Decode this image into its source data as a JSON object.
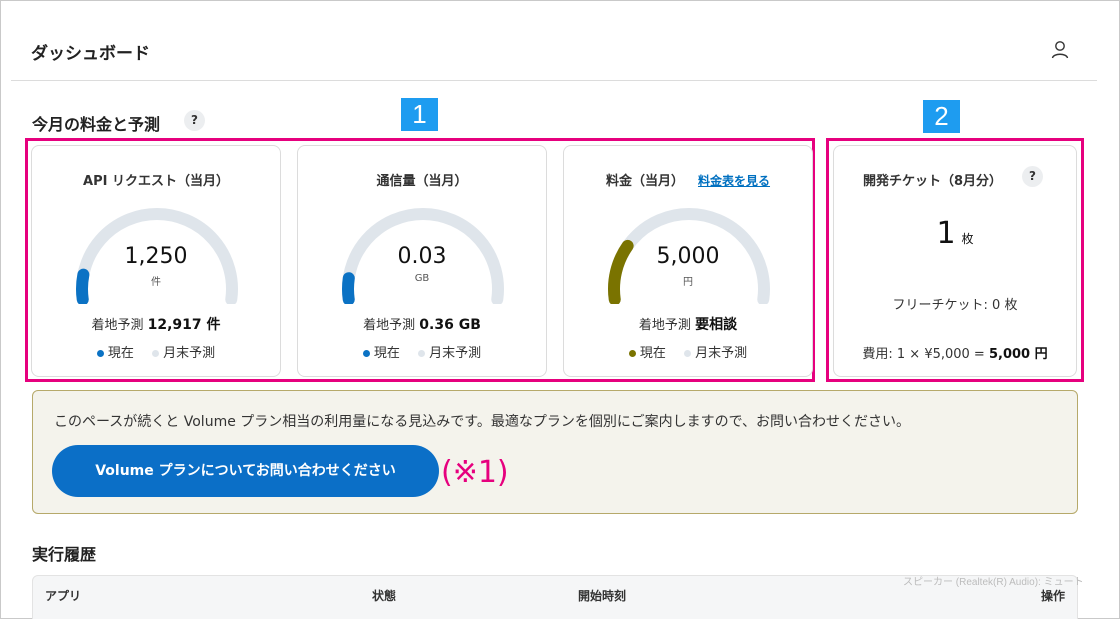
{
  "header": {
    "title": "ダッシュボード",
    "user_icon": "user-icon"
  },
  "billing": {
    "title": "今月の料金と予測",
    "help": "?",
    "markers": [
      "1",
      "2"
    ],
    "cards": [
      {
        "title": "API リクエスト（当月）",
        "value": "1,250",
        "unit": "件",
        "forecast_label": "着地予測",
        "forecast_value": "12,917 件",
        "legend_current": "現在",
        "legend_forecast": "月末予測",
        "progress": 0.097,
        "color": "#0b72c4"
      },
      {
        "title": "通信量（当月）",
        "value": "0.03",
        "unit": "GB",
        "forecast_label": "着地予測",
        "forecast_value": "0.36 GB",
        "legend_current": "現在",
        "legend_forecast": "月末予測",
        "progress": 0.083,
        "color": "#0b72c4"
      },
      {
        "title": "料金（当月）",
        "link": "料金表を見る",
        "value": "5,000",
        "unit": "円",
        "forecast_label": "着地予測",
        "forecast_value": "要相談",
        "legend_current": "現在",
        "legend_forecast": "月末予測",
        "progress": 0.22,
        "color": "#7a7300"
      }
    ],
    "ticket": {
      "title": "開発チケット（8月分）",
      "help": "?",
      "count": "1",
      "count_unit": "枚",
      "free": "フリーチケット: 0 枚",
      "cost_label": "費用: 1 × ¥5,000 = ",
      "cost_total": "5,000 円"
    }
  },
  "notice": {
    "message": "このペースが続くと Volume プラン相当の利用量になる見込みです。最適なプランを個別にご案内しますので、お問い合わせください。",
    "button": "Volume プランについてお問い合わせください",
    "annotation": "(※1)"
  },
  "history": {
    "title": "実行履歴",
    "columns": [
      "アプリ",
      "状態",
      "開始時刻",
      "操作"
    ]
  },
  "overlay": "スピーカー (Realtek(R) Audio): ミュート",
  "colors": {
    "accent": "#0b6fc7",
    "highlight": "#e6007e",
    "marker": "#1e9cf0",
    "track": "#dfe5eb"
  }
}
